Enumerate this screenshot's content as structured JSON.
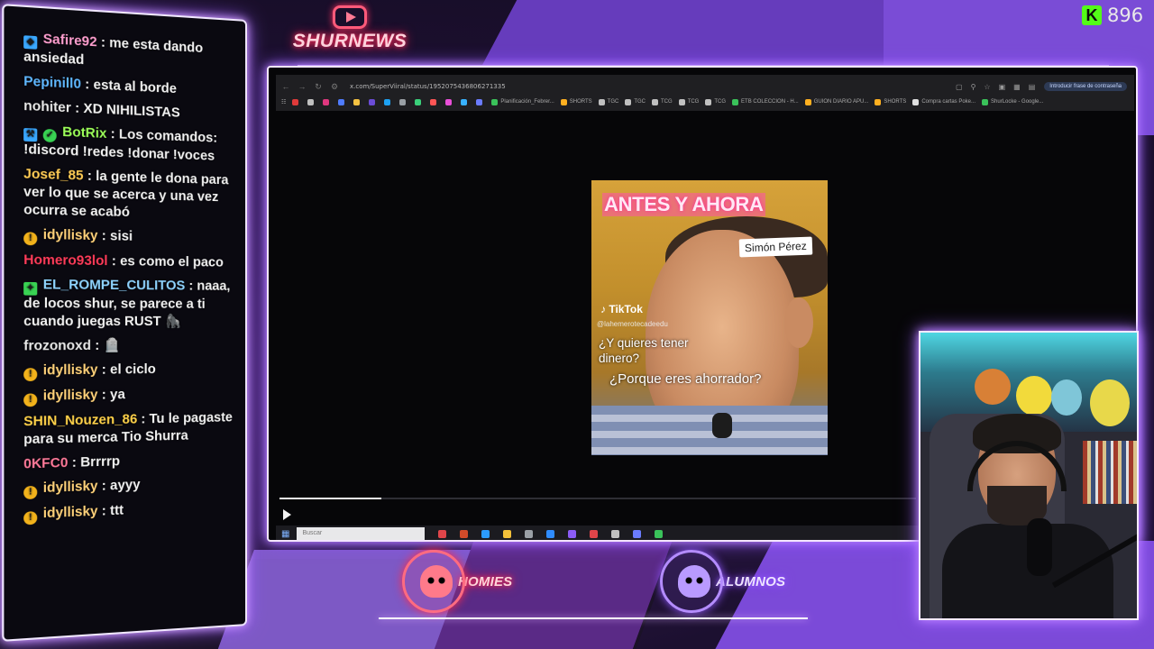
{
  "header": {
    "logo_text": "SHURNEWS",
    "logo_icon": "youtube-play-icon",
    "counter_icon": "kick-logo-icon",
    "counter_icon_letter": "K",
    "counter_value": "896"
  },
  "chat": {
    "messages": [
      {
        "user": "Safire92",
        "user_color": "#ff9fd0",
        "sep": " : ",
        "text": "me esta dando ansiedad",
        "badge": "diamond"
      },
      {
        "user": "Pepinill0",
        "user_color": "#5fb7ff",
        "sep": " : ",
        "text": "esta al borde",
        "badge": ""
      },
      {
        "user": "nohiter",
        "user_color": "#e8e8e8",
        "sep": " : ",
        "text": "XD NIHILISTAS",
        "badge": ""
      },
      {
        "user": "BotRix",
        "user_color": "#9dff5a",
        "sep": " : ",
        "text": "Los comandos: !discord !redes !donar !voces",
        "badge": "bot"
      },
      {
        "user": "Josef_85",
        "user_color": "#ffcc55",
        "sep": " : ",
        "text": "la gente le dona para ver lo que se acerca y una vez ocurra se acabó",
        "badge": ""
      },
      {
        "user": "idyllisky",
        "user_color": "#ffd27a",
        "sep": " : ",
        "text": "sisi",
        "badge": "gold"
      },
      {
        "user": "Homero93lol",
        "user_color": "#ff3c5a",
        "sep": " : ",
        "text": "es como el paco",
        "badge": ""
      },
      {
        "user": "EL_ROMPE_CULITOS",
        "user_color": "#8fd4ff",
        "sep": " : ",
        "text": "naaa, de locos shur, se parece a ti cuando juegas RUST 🦍",
        "badge": "green"
      },
      {
        "user": "frozonoxd",
        "user_color": "#e8e8e8",
        "sep": " : ",
        "text": "🪦",
        "badge": ""
      },
      {
        "user": "idyllisky",
        "user_color": "#ffd27a",
        "sep": " : ",
        "text": "el ciclo",
        "badge": "gold"
      },
      {
        "user": "idyllisky",
        "user_color": "#ffd27a",
        "sep": " : ",
        "text": "ya",
        "badge": "gold"
      },
      {
        "user": "SHIN_Nouzen_86",
        "user_color": "#ffd24a",
        "sep": " : ",
        "text": "Tu le pagaste para su merca Tio Shurra",
        "badge": ""
      },
      {
        "user": "0KFC0",
        "user_color": "#ff7a9a",
        "sep": " : ",
        "text": "Brrrrp",
        "badge": ""
      },
      {
        "user": "idyllisky",
        "user_color": "#ffd27a",
        "sep": " : ",
        "text": "ayyy",
        "badge": "gold"
      },
      {
        "user": "idyllisky",
        "user_color": "#ffd27a",
        "sep": " : ",
        "text": "ttt",
        "badge": "gold"
      }
    ]
  },
  "browser": {
    "url": "x.com/SuperViiral/status/1952075436806271335",
    "password_chip": "Introducir frase de contraseña",
    "bookmarks": [
      {
        "label": "",
        "color": "#e03a3a"
      },
      {
        "label": "",
        "color": "#c0c0c0"
      },
      {
        "label": "",
        "color": "#e0377f"
      },
      {
        "label": "",
        "color": "#4f7cff"
      },
      {
        "label": "",
        "color": "#f5c242"
      },
      {
        "label": "",
        "color": "#6b4cd6"
      },
      {
        "label": "",
        "color": "#1da1f2"
      },
      {
        "label": "",
        "color": "#9aa0a6"
      },
      {
        "label": "",
        "color": "#3ad07a"
      },
      {
        "label": "",
        "color": "#ff5555"
      },
      {
        "label": "",
        "color": "#e94fd8"
      },
      {
        "label": "",
        "color": "#38b2ff"
      },
      {
        "label": "",
        "color": "#6b7cff"
      },
      {
        "label": "Planificación_Febrer...",
        "color": "#3ac25a"
      },
      {
        "label": "SHORTS",
        "color": "#ffb020"
      },
      {
        "label": "TGC",
        "color": "#c0c0c0"
      },
      {
        "label": "TGC",
        "color": "#c0c0c0"
      },
      {
        "label": "TCG",
        "color": "#c0c0c0"
      },
      {
        "label": "TCG",
        "color": "#c0c0c0"
      },
      {
        "label": "TCG",
        "color": "#c0c0c0"
      },
      {
        "label": "ETB COLECCION - H...",
        "color": "#3ac25a"
      },
      {
        "label": "GUION DIARIO APU...",
        "color": "#ffb020"
      },
      {
        "label": "SHORTS",
        "color": "#ffb020"
      },
      {
        "label": "Compra cartas Poke...",
        "color": "#e0e0e0"
      },
      {
        "label": "ShurLocke - Google...",
        "color": "#3ac25a"
      }
    ],
    "video": {
      "title_overlay": "ANTES Y AHORA",
      "name_tag": "Simón Pérez",
      "tiktok_label": "TikTok",
      "tiktok_handle": "@lahemerotecadeedu",
      "subtitle_1": "¿Y quieres tener dinero?",
      "subtitle_2": "¿Porque eres ahorrador?",
      "progress": 0.16
    },
    "taskbar": {
      "search_placeholder": "Buscar",
      "app_colors": [
        "#e0454a",
        "#d24b2a",
        "#2b9cff",
        "#f3c13a",
        "#9aa0a6",
        "#2f8cff",
        "#8b5cf6",
        "#e0454a",
        "#c0c0c0",
        "#6b7cff",
        "#3ac25a"
      ]
    }
  },
  "footer": {
    "homies_label": "HOMIES",
    "alumnos_label": "ALUMNOS"
  }
}
